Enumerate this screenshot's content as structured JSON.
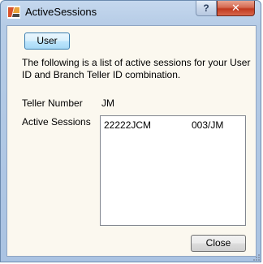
{
  "window": {
    "title": "ActiveSessions",
    "help_label": "?",
    "close_label": "✕"
  },
  "content": {
    "user_button": "User",
    "description": "The following is a list of active sessions for your User ID and Branch Teller ID combination.",
    "teller_label": "Teller Number",
    "teller_value": "JM",
    "sessions_label": "Active Sessions",
    "sessions": [
      {
        "id": "22222JCM",
        "teller": "003/JM"
      }
    ],
    "close_button": "Close"
  },
  "colors": {
    "client_background": "#fbf8ef",
    "titlebar": "#b6cce6",
    "close_button_red": "#c0391f"
  },
  "icons": {
    "app": "app-logo-icon",
    "help": "help-icon",
    "close": "close-icon"
  }
}
